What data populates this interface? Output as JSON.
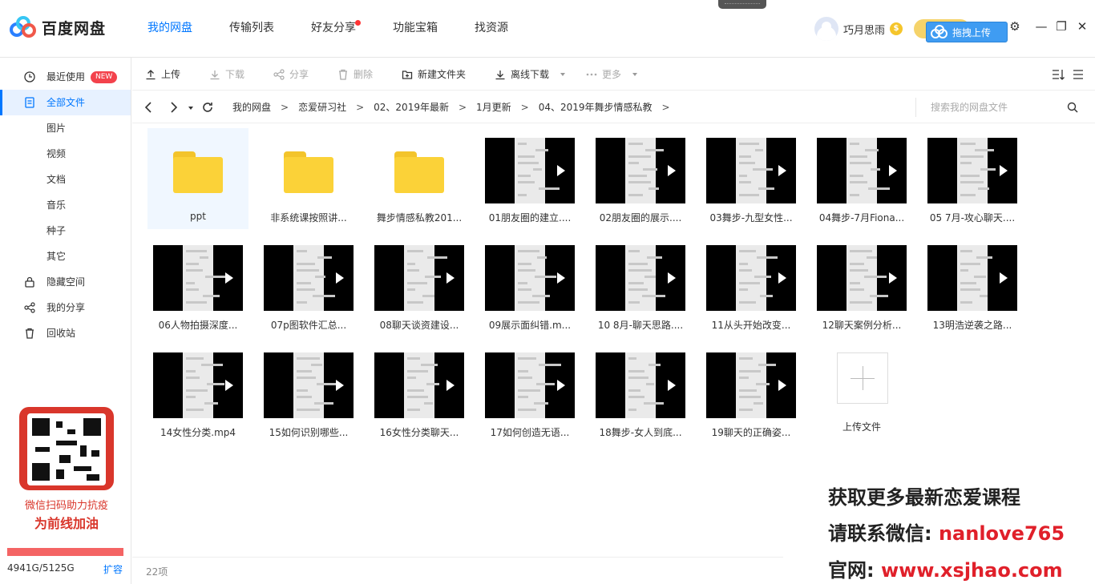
{
  "app": {
    "name": "百度网盘",
    "nav": [
      {
        "label": "我的网盘",
        "active": true
      },
      {
        "label": "传输列表",
        "active": false
      },
      {
        "label": "好友分享",
        "active": false,
        "dot": true
      },
      {
        "label": "功能宝箱",
        "active": false
      },
      {
        "label": "找资源",
        "active": false
      }
    ],
    "username": "巧月思雨",
    "vip_symbol": "$",
    "drag_upload_label": "拖拽上传",
    "window_controls": {
      "settings": "⚙",
      "minimize": "—",
      "maximize": "❐",
      "close": "✕"
    }
  },
  "sidebar": {
    "items": [
      {
        "label": "最近使用",
        "icon": "clock-icon",
        "badge": "NEW"
      },
      {
        "label": "全部文件",
        "icon": "file-icon",
        "active": true
      },
      {
        "label": "图片"
      },
      {
        "label": "视频"
      },
      {
        "label": "文档"
      },
      {
        "label": "音乐"
      },
      {
        "label": "种子"
      },
      {
        "label": "其它"
      },
      {
        "label": "隐藏空间",
        "icon": "lock-icon"
      },
      {
        "label": "我的分享",
        "icon": "share-icon"
      },
      {
        "label": "回收站",
        "icon": "trash-icon"
      }
    ],
    "promo_line1": "微信扫码助力抗疫",
    "promo_line2": "为前线加油",
    "quota": "4941G/5125G",
    "quota_used_fraction": 0.964,
    "expand_label": "扩容"
  },
  "toolbar": {
    "upload": "上传",
    "download": "下载",
    "share": "分享",
    "delete": "删除",
    "new_folder": "新建文件夹",
    "offline_download": "离线下载",
    "more": "更多"
  },
  "path": {
    "crumbs": [
      "我的网盘",
      "恋爱研习社",
      "02、2019年最新",
      "1月更新",
      "04、2019年舞步情感私教"
    ],
    "search_placeholder": "搜索我的网盘文件"
  },
  "files": [
    {
      "name": "ppt",
      "type": "folder"
    },
    {
      "name": "非系统课按照讲...",
      "type": "folder"
    },
    {
      "name": "舞步情感私教201...",
      "type": "folder"
    },
    {
      "name": "01朋友圈的建立....",
      "type": "video"
    },
    {
      "name": "02朋友圈的展示....",
      "type": "video"
    },
    {
      "name": "03舞步-九型女性...",
      "type": "video"
    },
    {
      "name": "04舞步-7月Fiona...",
      "type": "video"
    },
    {
      "name": "05 7月-攻心聊天....",
      "type": "video"
    },
    {
      "name": "06人物拍摄深度...",
      "type": "video"
    },
    {
      "name": "07p图软件汇总...",
      "type": "video"
    },
    {
      "name": "08聊天谈资建设...",
      "type": "video"
    },
    {
      "name": "09展示面纠错.m...",
      "type": "video"
    },
    {
      "name": "10 8月-聊天思路....",
      "type": "video"
    },
    {
      "name": "11从头开始改变...",
      "type": "video"
    },
    {
      "name": "12聊天案例分析...",
      "type": "video"
    },
    {
      "name": "13明浩逆袭之路...",
      "type": "video"
    },
    {
      "name": "14女性分类.mp4",
      "type": "video"
    },
    {
      "name": "15如何识别哪些...",
      "type": "video"
    },
    {
      "name": "16女性分类聊天...",
      "type": "video"
    },
    {
      "name": "17如何创造无语...",
      "type": "video"
    },
    {
      "name": "18舞步-女人到底...",
      "type": "video"
    },
    {
      "name": "19聊天的正确姿...",
      "type": "video"
    }
  ],
  "upload_tile_label": "上传文件",
  "status": {
    "count": "22项"
  },
  "watermark": {
    "line1": "获取更多最新恋爱课程",
    "line2_prefix": "请联系微信: ",
    "line2_value": "nanlove765",
    "line3_prefix": "官网: ",
    "line3_value": "www.xsjhao.com"
  },
  "colors": {
    "accent": "#0077ff",
    "folder": "#fbd238",
    "badge": "#f3424c",
    "quota": "#f46464",
    "watermark_red": "#e0202a"
  }
}
